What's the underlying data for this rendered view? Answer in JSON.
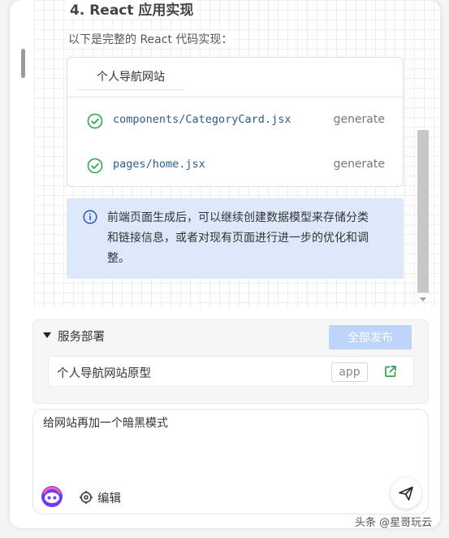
{
  "section": {
    "heading": "4. React 应用实现",
    "intro": "以下是完整的 React 代码实现："
  },
  "files_card": {
    "title": "个人导航网站",
    "files": [
      {
        "name": "components/CategoryCard.jsx",
        "status": "generate"
      },
      {
        "name": "pages/home.jsx",
        "status": "generate"
      }
    ]
  },
  "info_box": {
    "icon": "info-icon",
    "text": "前端页面生成后，可以继续创建数据模型来存储分类和链接信息，或者对现有页面进行进一步的优化和调整。"
  },
  "deploy": {
    "title": "服务部署",
    "publish_all_label": "全部发布",
    "item": {
      "name": "个人导航网站原型",
      "tag": "app"
    }
  },
  "chat_input": {
    "value": "给网站再加一个暗黑模式",
    "edit_label": "编辑"
  },
  "watermark": "头条 @星哥玩云",
  "colors": {
    "accent_green": "#2ea44f",
    "info_bg": "#dde9fb",
    "publish_button_bg": "#bcd5f8",
    "link_blue": "#2a5d90",
    "avatar_purple": "#6b3df5"
  }
}
